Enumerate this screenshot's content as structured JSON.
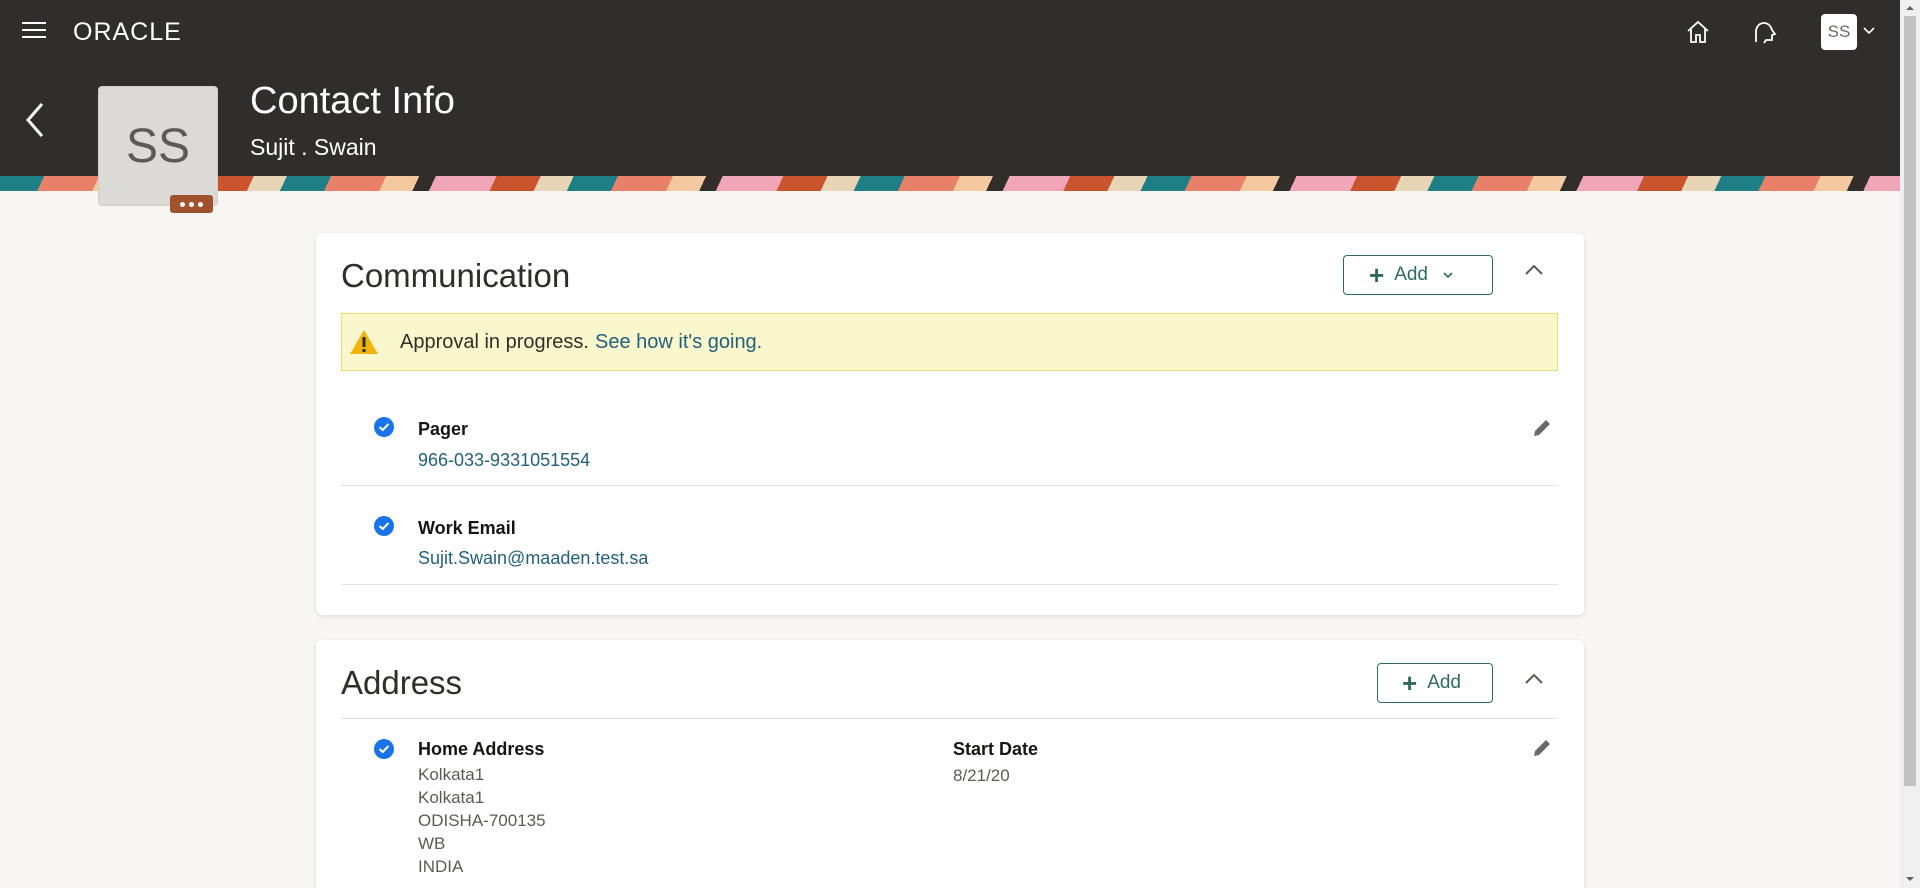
{
  "topbar": {
    "logo_text": "ORACLE",
    "user_initials": "SS"
  },
  "header": {
    "title": "Contact Info",
    "subtitle": "Sujit . Swain",
    "avatar_initials": "SS"
  },
  "communication": {
    "title": "Communication",
    "add_label": "Add",
    "approval_text": "Approval in progress.",
    "approval_link": "See how it's going.",
    "items": [
      {
        "label": "Pager",
        "value": "966-033-9331051554"
      },
      {
        "label": "Work Email",
        "value": "Sujit.Swain@maaden.test.sa"
      }
    ]
  },
  "address": {
    "title": "Address",
    "add_label": "Add",
    "item": {
      "label": "Home Address",
      "lines": [
        "Kolkata1",
        "Kolkata1",
        "ODISHA-700135",
        "WB",
        "INDIA"
      ],
      "start_date_label": "Start Date",
      "start_date": "8/21/20"
    }
  },
  "colors": {
    "header_bg": "#312d2a",
    "accent_green": "#2d6b5f",
    "link_blue": "#22607d",
    "check_blue": "#1a73e8",
    "warning_bg": "#fbf7cd"
  }
}
